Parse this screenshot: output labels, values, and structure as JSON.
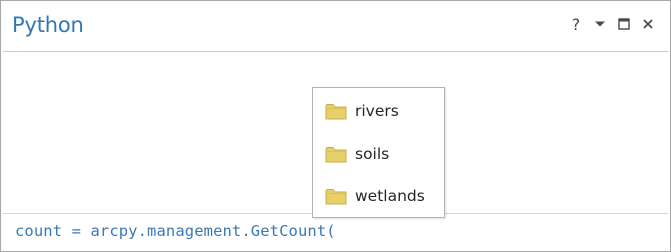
{
  "window": {
    "title": "Python",
    "controls": {
      "help_label": "?",
      "menu_icon": "chevron-down-icon",
      "maximize_icon": "maximize-icon",
      "close_icon": "close-icon"
    }
  },
  "input": {
    "code": "count = arcpy.management.GetCount("
  },
  "autocomplete": {
    "items": [
      {
        "label": "rivers",
        "icon": "folder-icon"
      },
      {
        "label": "soils",
        "icon": "folder-icon"
      },
      {
        "label": "wetlands",
        "icon": "folder-icon"
      }
    ]
  },
  "colors": {
    "title": "#3078b6",
    "code": "#3a78b5",
    "folder_fill": "#e7cf6a",
    "folder_stroke": "#c9ad45"
  }
}
